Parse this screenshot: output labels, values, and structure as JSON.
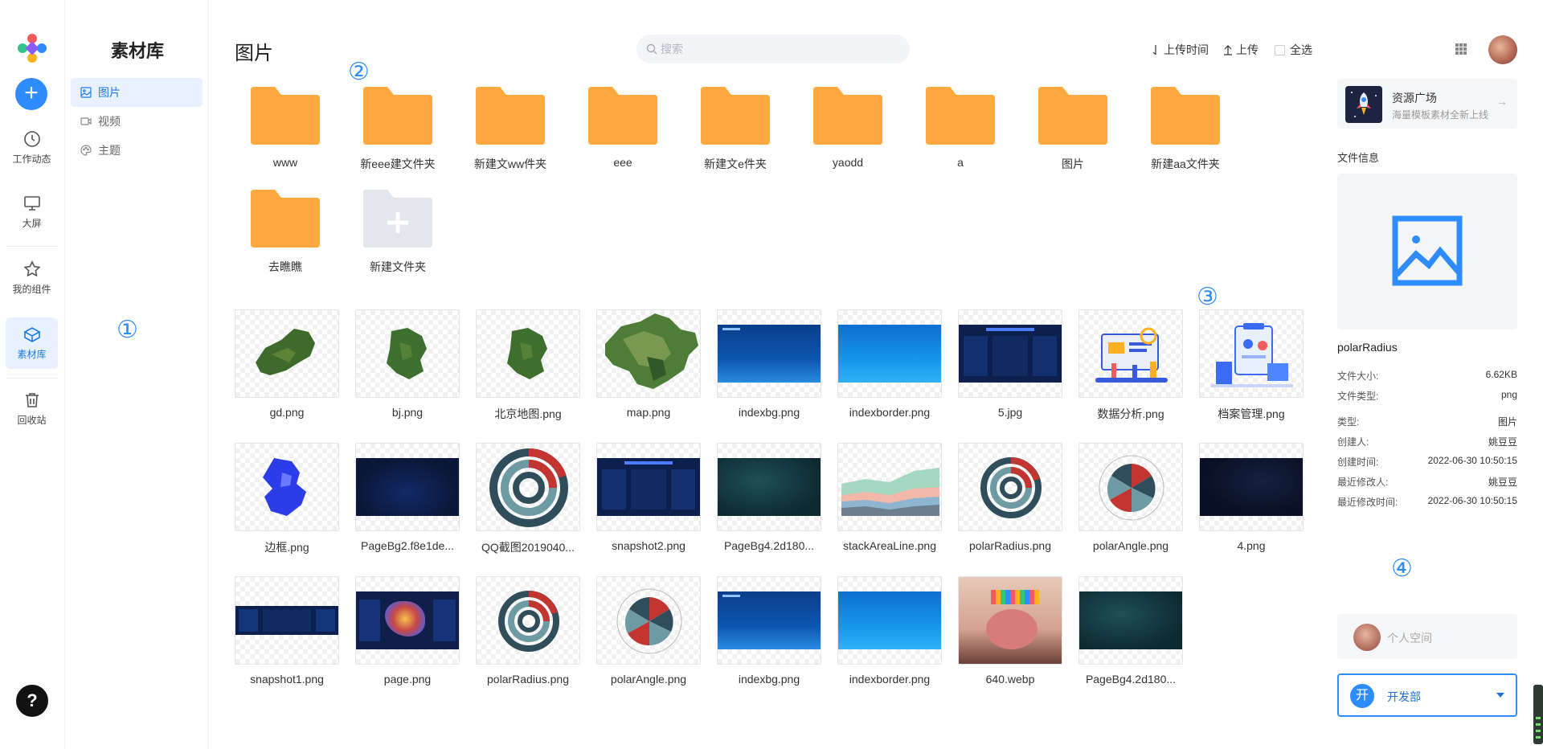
{
  "app": {
    "nav": [
      {
        "label": "工作动态",
        "icon": "clock-icon"
      },
      {
        "label": "大屏",
        "icon": "monitor-icon"
      },
      {
        "label": "我的组件",
        "icon": "star-icon"
      },
      {
        "label": "素材库",
        "icon": "box-icon",
        "active": true
      },
      {
        "label": "回收站",
        "icon": "trash-icon"
      }
    ],
    "add_label": "+",
    "help_label": "?"
  },
  "sidebar": {
    "title": "素材库",
    "items": [
      {
        "label": "图片",
        "icon": "image-icon",
        "active": true
      },
      {
        "label": "视频",
        "icon": "video-icon"
      },
      {
        "label": "主题",
        "icon": "palette-icon"
      }
    ]
  },
  "markers": [
    "①",
    "②",
    "③",
    "④"
  ],
  "header": {
    "title": "图片",
    "search_placeholder": "搜索",
    "sort_label": "上传时间",
    "upload_label": "上传",
    "select_all_label": "全选"
  },
  "folders": [
    {
      "name": "www"
    },
    {
      "name": "新eee建文件夹"
    },
    {
      "name": "新建文ww件夹"
    },
    {
      "name": "eee"
    },
    {
      "name": "新建文e件夹"
    },
    {
      "name": "yaodd"
    },
    {
      "name": "a"
    },
    {
      "name": "图片"
    },
    {
      "name": "新建aa文件夹"
    },
    {
      "name": "去瞧瞧"
    }
  ],
  "new_folder_label": "新建文件夹",
  "files": [
    {
      "name": "gd.png",
      "kind": "map-green"
    },
    {
      "name": "bj.png",
      "kind": "map-green-small"
    },
    {
      "name": "北京地图.png",
      "kind": "map-green-small"
    },
    {
      "name": "map.png",
      "kind": "map-china"
    },
    {
      "name": "indexbg.png",
      "kind": "blue-screen"
    },
    {
      "name": "indexborder.png",
      "kind": "blue-gradient"
    },
    {
      "name": "5.jpg",
      "kind": "dashboard-dark"
    },
    {
      "name": "数据分析.png",
      "kind": "illustration"
    },
    {
      "name": "档案管理.png",
      "kind": "illustration-doc"
    },
    {
      "name": "边框.png",
      "kind": "map-blue"
    },
    {
      "name": "PageBg2.f8e1de...",
      "kind": "navy-dark"
    },
    {
      "name": "QQ截图2019040...",
      "kind": "polar-radius-large"
    },
    {
      "name": "snapshot2.png",
      "kind": "dashboard-dark"
    },
    {
      "name": "PageBg4.2d180...",
      "kind": "teal-dark"
    },
    {
      "name": "stackAreaLine.png",
      "kind": "stack-area"
    },
    {
      "name": "polarRadius.png",
      "kind": "polar-radius"
    },
    {
      "name": "polarAngle.png",
      "kind": "polar-angle"
    },
    {
      "name": "4.png",
      "kind": "navy-darker"
    },
    {
      "name": "snapshot1.png",
      "kind": "dashboard-strip"
    },
    {
      "name": "page.png",
      "kind": "dashboard-map"
    },
    {
      "name": "polarRadius.png",
      "kind": "polar-radius"
    },
    {
      "name": "polarAngle.png",
      "kind": "polar-angle"
    },
    {
      "name": "indexbg.png",
      "kind": "blue-screen"
    },
    {
      "name": "indexborder.png",
      "kind": "blue-gradient"
    },
    {
      "name": "640.webp",
      "kind": "photo"
    },
    {
      "name": "PageBg4.2d180...",
      "kind": "teal-dark"
    }
  ],
  "panel": {
    "promo_title": "资源广场",
    "promo_subtitle": "海量模板素材全新上线",
    "info_title": "文件信息",
    "file_name": "polarRadius",
    "meta": [
      {
        "label": "文件大小:",
        "value": "6.62KB"
      },
      {
        "label": "文件类型:",
        "value": "png"
      },
      {
        "label": "类型:",
        "value": "图片"
      },
      {
        "label": "创建人:",
        "value": "姚豆豆"
      },
      {
        "label": "创建时间:",
        "value": "2022-06-30 10:50:15"
      },
      {
        "label": "最近修改人:",
        "value": "姚豆豆"
      },
      {
        "label": "最近修改时间:",
        "value": "2022-06-30 10:50:15"
      }
    ],
    "space_label": "个人空间",
    "dept_avatar": "开",
    "dept_label": "开发部"
  },
  "colors": {
    "accent": "#2f8cff",
    "folder": "#ffa940",
    "active_bg": "#e8f2ff"
  }
}
